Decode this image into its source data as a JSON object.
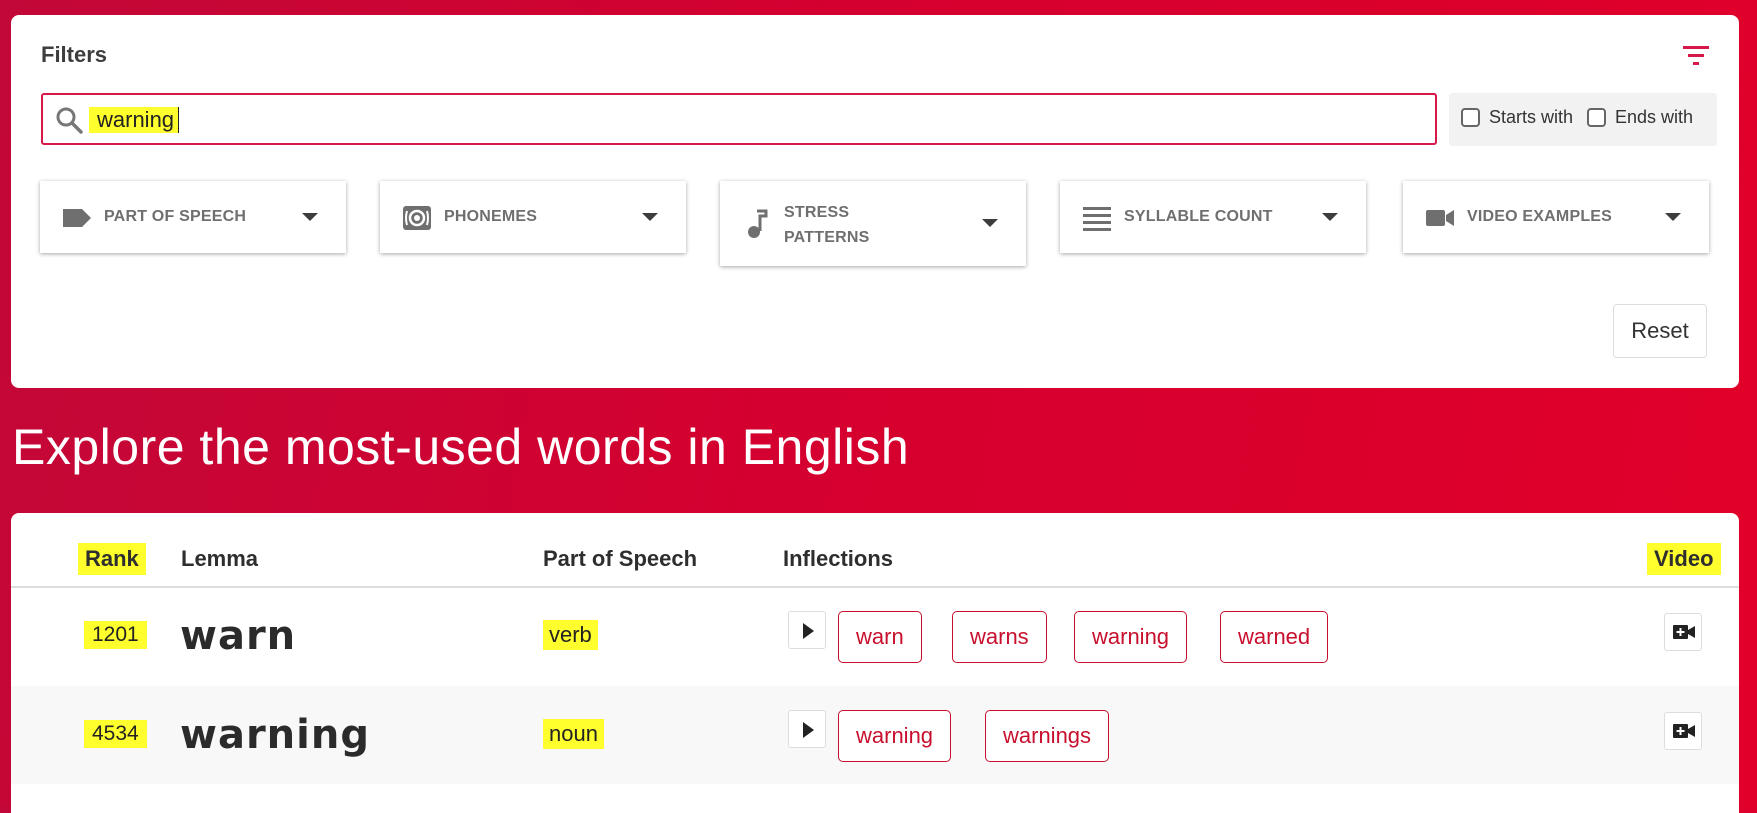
{
  "filters": {
    "title": "Filters",
    "search_value": "warning",
    "starts_with_label": "Starts with",
    "ends_with_label": "Ends with",
    "dropdowns": [
      {
        "label": "PART OF SPEECH",
        "icon": "tag-icon"
      },
      {
        "label": "PHONEMES",
        "icon": "phoneme-icon"
      },
      {
        "label": "STRESS PATTERNS",
        "icon": "music-note-icon"
      },
      {
        "label": "SYLLABLE COUNT",
        "icon": "lines-icon"
      },
      {
        "label": "VIDEO EXAMPLES",
        "icon": "video-camera-icon"
      }
    ],
    "reset_label": "Reset"
  },
  "headline": "Explore the most-used words in English",
  "table": {
    "headers": {
      "rank": "Rank",
      "lemma": "Lemma",
      "pos": "Part of Speech",
      "inflections": "Inflections",
      "video": "Video"
    },
    "rows": [
      {
        "rank": "1201",
        "lemma": "warn",
        "pos": "verb",
        "inflections": [
          "warn",
          "warns",
          "warning",
          "warned"
        ]
      },
      {
        "rank": "4534",
        "lemma": "warning",
        "pos": "noun",
        "inflections": [
          "warning",
          "warnings"
        ]
      }
    ]
  },
  "colors": {
    "accent": "#c8102e",
    "highlight": "#ffff2e",
    "background": "#d4002f"
  }
}
